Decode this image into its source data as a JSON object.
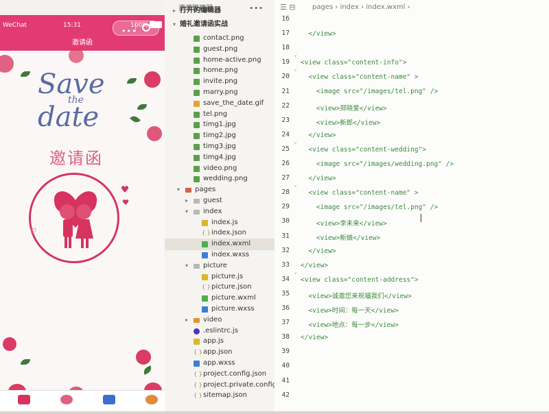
{
  "simulator": {
    "carrier": "WeChat",
    "time": "15:31",
    "battery": "100%",
    "nav_title": "邀请函",
    "capsule_dots": "•••",
    "save_line1": "Save",
    "save_line2": "the",
    "save_line3": "date",
    "invite_text": "邀请函",
    "accent_color": "#e23b74"
  },
  "explorer": {
    "title": "资源管理器",
    "more": "•••",
    "sections": [
      {
        "label": "打开的编辑器",
        "arrow": "▸"
      },
      {
        "label": "婚礼邀请函实战",
        "arrow": "▾"
      }
    ],
    "items": [
      {
        "label": "contact.png",
        "icon": "png"
      },
      {
        "label": "guest.png",
        "icon": "png"
      },
      {
        "label": "home-active.png",
        "icon": "png"
      },
      {
        "label": "home.png",
        "icon": "png"
      },
      {
        "label": "invite.png",
        "icon": "png"
      },
      {
        "label": "marry.png",
        "icon": "png"
      },
      {
        "label": "save_the_date.gif",
        "icon": "gif"
      },
      {
        "label": "tel.png",
        "icon": "png"
      },
      {
        "label": "timg1.jpg",
        "icon": "png"
      },
      {
        "label": "timg2.jpg",
        "icon": "png"
      },
      {
        "label": "timg3.jpg",
        "icon": "png"
      },
      {
        "label": "timg4.jpg",
        "icon": "png"
      },
      {
        "label": "video.png",
        "icon": "png"
      },
      {
        "label": "wedding.png",
        "icon": "png"
      },
      {
        "label": "pages",
        "icon": "folder-red",
        "arrow": "▾"
      },
      {
        "label": "guest",
        "icon": "folder",
        "arrow": "▸"
      },
      {
        "label": "index",
        "icon": "folder",
        "arrow": "▾"
      },
      {
        "label": "index.js",
        "icon": "js"
      },
      {
        "label": "index.json",
        "icon": "json"
      },
      {
        "label": "index.wxml",
        "icon": "wxml"
      },
      {
        "label": "index.wxss",
        "icon": "wxss"
      },
      {
        "label": "picture",
        "icon": "folder",
        "arrow": "▾"
      },
      {
        "label": "picture.js",
        "icon": "js"
      },
      {
        "label": "picture.json",
        "icon": "json"
      },
      {
        "label": "picture.wxml",
        "icon": "wxml"
      },
      {
        "label": "picture.wxss",
        "icon": "wxss"
      },
      {
        "label": "video",
        "icon": "folder-orange",
        "arrow": "▸"
      },
      {
        "label": ".eslintrc.js",
        "icon": "eslint"
      },
      {
        "label": "app.js",
        "icon": "js"
      },
      {
        "label": "app.json",
        "icon": "json"
      },
      {
        "label": "app.wxss",
        "icon": "wxss"
      },
      {
        "label": "project.config.json",
        "icon": "json"
      },
      {
        "label": "project.private.config.js...",
        "icon": "json"
      },
      {
        "label": "sitemap.json",
        "icon": "json"
      }
    ]
  },
  "editor": {
    "toolbar_icons": "☰  ⊟",
    "breadcrumb": "pages  ›  index  ›  index.wxml  ›",
    "lines": [
      {
        "n": "16",
        "code": "  </view>"
      },
      {
        "n": "17",
        "code": ""
      },
      {
        "n": "18",
        "code": "<view class=\"content-info\">"
      },
      {
        "n": "19",
        "code": "  <view class=\"content-name\" >"
      },
      {
        "n": "20",
        "code": "    <image src=\"/images/tel.png\" />"
      },
      {
        "n": "21",
        "code": "    <view>郑晓爱</view>"
      },
      {
        "n": "22",
        "code": "    <view>新郎</view>"
      },
      {
        "n": "23",
        "code": "  </view>"
      },
      {
        "n": "24",
        "code": "  <view class=\"content-wedding\">"
      },
      {
        "n": "25",
        "code": "    <image src=\"/images/wedding.png\" />"
      },
      {
        "n": "26",
        "code": "  </view>"
      },
      {
        "n": "27",
        "code": "  <view class=\"content-name\" >"
      },
      {
        "n": "28",
        "code": "    <image src=\"/images/tel.png\" />"
      },
      {
        "n": "29",
        "code": "    <view>李未来</view>"
      },
      {
        "n": "30",
        "code": "    <view>新娘</view>"
      },
      {
        "n": "31",
        "code": "  </view>"
      },
      {
        "n": "32",
        "code": "</view>"
      },
      {
        "n": "33",
        "code": "<view class=\"content-address\">"
      },
      {
        "n": "34",
        "code": "  <view>诚邀您来祝福我们</view>"
      },
      {
        "n": "35",
        "code": "  <view>时间：每一天</view>"
      },
      {
        "n": "36",
        "code": "  <view>地点：每一步</view>"
      },
      {
        "n": "37",
        "code": "</view>"
      },
      {
        "n": "38",
        "code": ""
      },
      {
        "n": "39",
        "code": ""
      },
      {
        "n": "40",
        "code": ""
      },
      {
        "n": "41",
        "code": ""
      },
      {
        "n": "42",
        "code": ""
      }
    ]
  }
}
